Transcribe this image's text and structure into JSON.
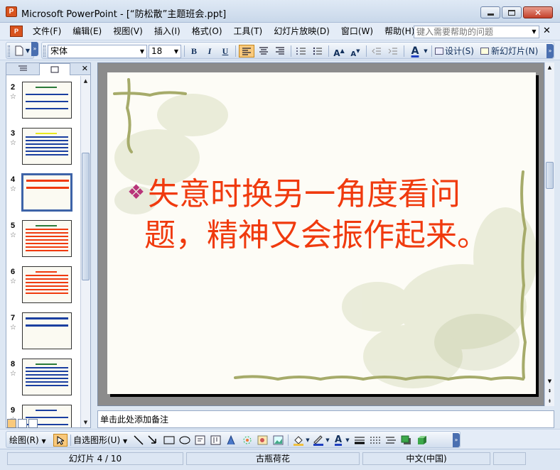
{
  "window": {
    "app_icon": "P",
    "title": "Microsoft PowerPoint - [“防松散”主题班会.ppt]",
    "close_glyph": "✕"
  },
  "menu": {
    "items": [
      "文件(F)",
      "编辑(E)",
      "视图(V)",
      "插入(I)",
      "格式(O)",
      "工具(T)",
      "幻灯片放映(D)",
      "窗口(W)",
      "帮助(H)"
    ],
    "help_placeholder": "键入需要帮助的问题",
    "close_doc": "✕"
  },
  "toolbar": {
    "font_name": "宋体",
    "font_size": "18",
    "bold": "B",
    "italic": "I",
    "underline": "U",
    "increase_font": "A",
    "decrease_font": "A",
    "font_color": "A",
    "design_label": "设计(S)",
    "new_slide_label": "新幻灯片(N)"
  },
  "panel": {
    "close": "✕",
    "thumbnails": [
      {
        "num": "2",
        "selected": false
      },
      {
        "num": "3",
        "selected": false
      },
      {
        "num": "4",
        "selected": true
      },
      {
        "num": "5",
        "selected": false
      },
      {
        "num": "6",
        "selected": false
      },
      {
        "num": "7",
        "selected": false
      },
      {
        "num": "8",
        "selected": false
      },
      {
        "num": "9",
        "selected": false
      }
    ]
  },
  "slide": {
    "bullet": "❖",
    "line1": "失意时换另一角度看问",
    "line2": "题，精神又会振作起来。",
    "text_color": "#f03a0e",
    "bullet_color": "#b8347a"
  },
  "notes": {
    "placeholder": "单击此处添加备注"
  },
  "drawbar": {
    "draw_label": "绘图(R)",
    "autoshapes_label": "自选图形(U)"
  },
  "status": {
    "slide_pos": "幻灯片 4 / 10",
    "design": "古瓶荷花",
    "language": "中文(中国)"
  }
}
